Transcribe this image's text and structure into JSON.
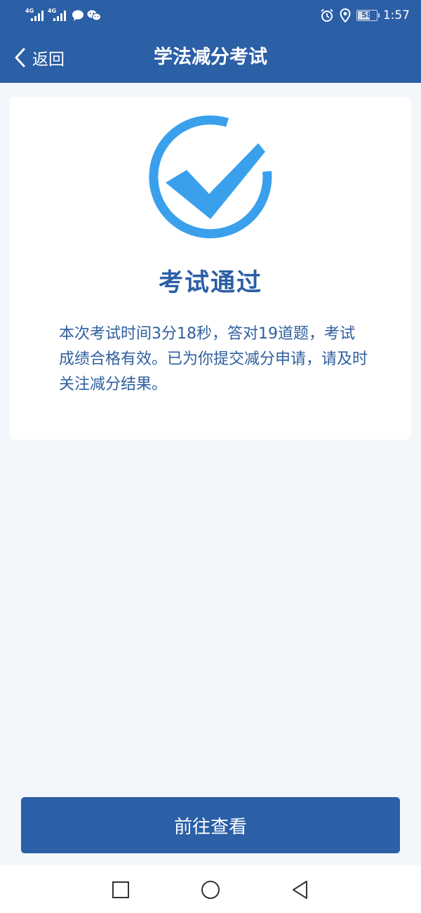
{
  "statusbar": {
    "sim1": "4G",
    "sim2": "4G",
    "battery_level": "58",
    "time": "1:57"
  },
  "header": {
    "back_label": "返回",
    "title": "学法减分考试"
  },
  "result": {
    "title": "考试通过",
    "description": "本次考试时间3分18秒，答对19道题，考试成绩合格有效。已为你提交减分申请，请及时关注减分结果。"
  },
  "actions": {
    "primary_label": "前往查看"
  },
  "colors": {
    "brand_blue": "#2b5fa6",
    "check_blue": "#3aa0ec",
    "page_bg": "#f3f7fb"
  },
  "icons": [
    "back-chevron-icon",
    "check-circle-icon",
    "alarm-icon",
    "location-icon",
    "message-icon",
    "wechat-icon",
    "nav-square-icon",
    "nav-circle-icon",
    "nav-triangle-icon"
  ]
}
